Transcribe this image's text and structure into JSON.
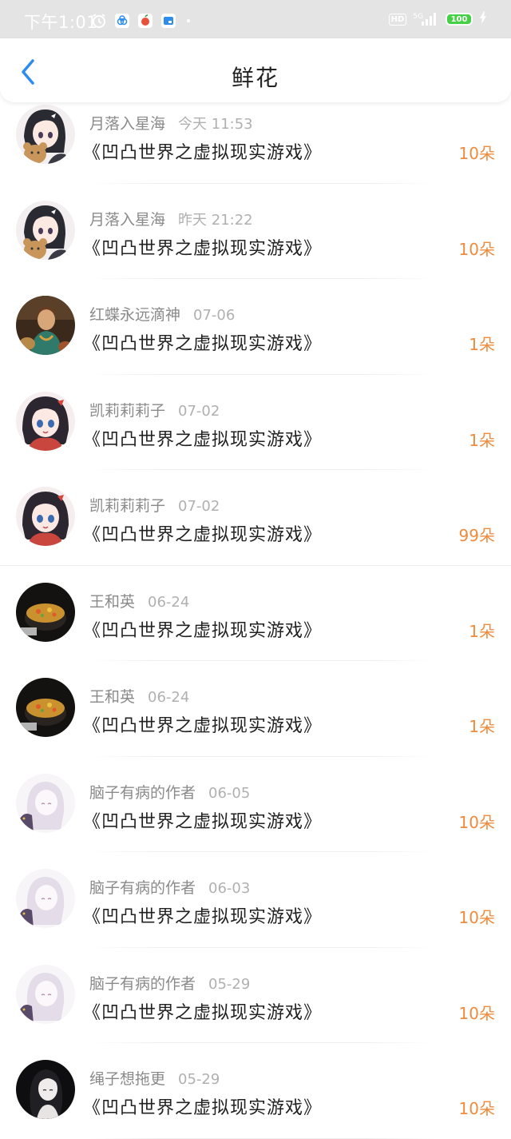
{
  "status_bar": {
    "time": "下午1:01",
    "network": "5G",
    "battery": "100"
  },
  "header": {
    "title": "鲜花"
  },
  "items": [
    {
      "user": "月落入星海",
      "time": "今天 11:53",
      "book": "《凹凸世界之虚拟现实游戏》",
      "count": "10朵",
      "avatar": "anime-girl-bear"
    },
    {
      "user": "月落入星海",
      "time": "昨天 21:22",
      "book": "《凹凸世界之虚拟现实游戏》",
      "count": "10朵",
      "avatar": "anime-girl-bear"
    },
    {
      "user": "红蝶永远滴神",
      "time": "07-06",
      "book": "《凹凸世界之虚拟现实游戏》",
      "count": "1朵",
      "avatar": "painting-portrait"
    },
    {
      "user": "凯莉莉莉子",
      "time": "07-02",
      "book": "《凹凸世界之虚拟现实游戏》",
      "count": "1朵",
      "avatar": "anime-girl-red"
    },
    {
      "user": "凯莉莉莉子",
      "time": "07-02",
      "book": "《凹凸世界之虚拟现实游戏》",
      "count": "99朵",
      "avatar": "anime-girl-red"
    },
    {
      "user": "王和英",
      "time": "06-24",
      "book": "《凹凸世界之虚拟现实游戏》",
      "count": "1朵",
      "avatar": "food-pot"
    },
    {
      "user": "王和英",
      "time": "06-24",
      "book": "《凹凸世界之虚拟现实游戏》",
      "count": "1朵",
      "avatar": "food-pot"
    },
    {
      "user": "脑子有病的作者",
      "time": "06-05",
      "book": "《凹凸世界之虚拟现实游戏》",
      "count": "10朵",
      "avatar": "sketch-girl"
    },
    {
      "user": "脑子有病的作者",
      "time": "06-03",
      "book": "《凹凸世界之虚拟现实游戏》",
      "count": "10朵",
      "avatar": "sketch-girl"
    },
    {
      "user": "脑子有病的作者",
      "time": "05-29",
      "book": "《凹凸世界之虚拟现实游戏》",
      "count": "10朵",
      "avatar": "sketch-girl"
    },
    {
      "user": "绳子想拖更",
      "time": "05-29",
      "book": "《凹凸世界之虚拟现实游戏》",
      "count": "10朵",
      "avatar": "dark-portrait"
    }
  ],
  "colors": {
    "count": "#f08a3c",
    "back_arrow": "#2d8cf0",
    "status_bar": "#e4e4e4"
  }
}
